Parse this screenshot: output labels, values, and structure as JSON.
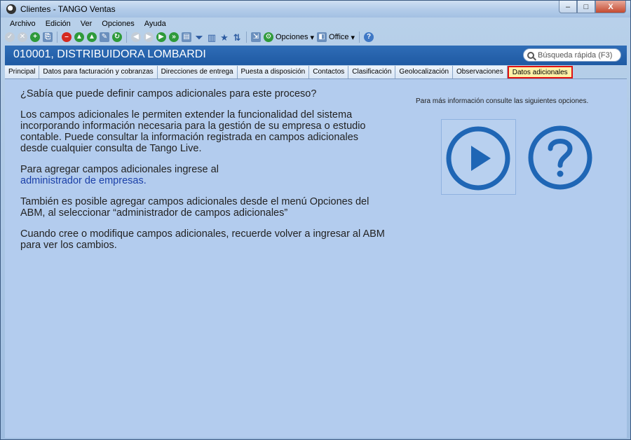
{
  "window": {
    "title": "Clientes - TANGO Ventas",
    "controls": {
      "minimize": "–",
      "maximize": "□",
      "close": "X"
    }
  },
  "menu": [
    "Archivo",
    "Edición",
    "Ver",
    "Opciones",
    "Ayuda"
  ],
  "toolbar": {
    "opciones_label": "Opciones",
    "office_label": "Office"
  },
  "header": {
    "record_title": "010001, DISTRIBUIDORA LOMBARDI",
    "search_placeholder": "Búsqueda rápida (F3)"
  },
  "tabs": [
    {
      "label": "Principal"
    },
    {
      "label": "Datos para facturación y cobranzas"
    },
    {
      "label": "Direcciones de entrega"
    },
    {
      "label": "Puesta a disposición"
    },
    {
      "label": "Contactos"
    },
    {
      "label": "Clasificación"
    },
    {
      "label": "Geolocalización"
    },
    {
      "label": "Observaciones"
    },
    {
      "label": "Datos adicionales",
      "active": true
    }
  ],
  "content": {
    "question": "¿Sabía que puede definir campos adicionales para este proceso?",
    "p1": "Los campos adicionales le permiten extender la funcionalidad del sistema incorporando información necesaria para la gestión de su empresa o estudio contable. Puede consultar la información registrada en campos adicionales desde cualquier consulta de Tango Live.",
    "p2_text": "Para agregar campos adicionales ingrese al",
    "p2_link": "administrador de empresas.",
    "p3": "También es posible agregar campos adicionales desde el menú Opciones del ABM, al seleccionar “administrador de campos adicionales”",
    "p4": "Cuando cree o modifique campos adicionales, recuerde volver a ingresar al ABM para ver los cambios.",
    "more_info": "Para más información consulte las siguientes opciones."
  },
  "colors": {
    "accent": "#1f66b5",
    "active_tab_bg": "#fff2a8",
    "active_tab_border": "#e01212",
    "content_bg": "#b3ccee"
  },
  "icons": [
    "play-circle-icon",
    "help-circle-icon"
  ]
}
